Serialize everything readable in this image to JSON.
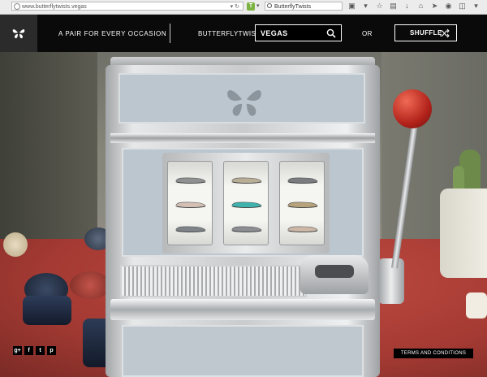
{
  "browser": {
    "url": "www.butterflytwists.vegas",
    "search_text": "ButterflyTwists",
    "addon_label": "T"
  },
  "nav": {
    "tagline": "A PAIR FOR EVERY OCCASION",
    "brand_label": "BUTTERFLYTWISTS.",
    "brand_value": "VEGAS",
    "or_label": "OR",
    "shuffle_label": "SHUFFLE"
  },
  "reels": [
    {
      "shoes": [
        "#8f9190",
        "#d3bfb4",
        "#7d8388"
      ]
    },
    {
      "shoes": [
        "#b8ae96",
        "#3fb2ad",
        "#8b8d92"
      ]
    },
    {
      "shoes": [
        "#7a7c80",
        "#b6a27b",
        "#cdb8a7"
      ]
    }
  ],
  "footer": {
    "social": [
      "g+",
      "f",
      "t",
      "p"
    ],
    "terms_label": "TERMS AND CONDITIONS"
  },
  "colors": {
    "nav_bg": "#0a0a0a",
    "felt": "#a8443b",
    "lever_ball": "#c0281f"
  }
}
